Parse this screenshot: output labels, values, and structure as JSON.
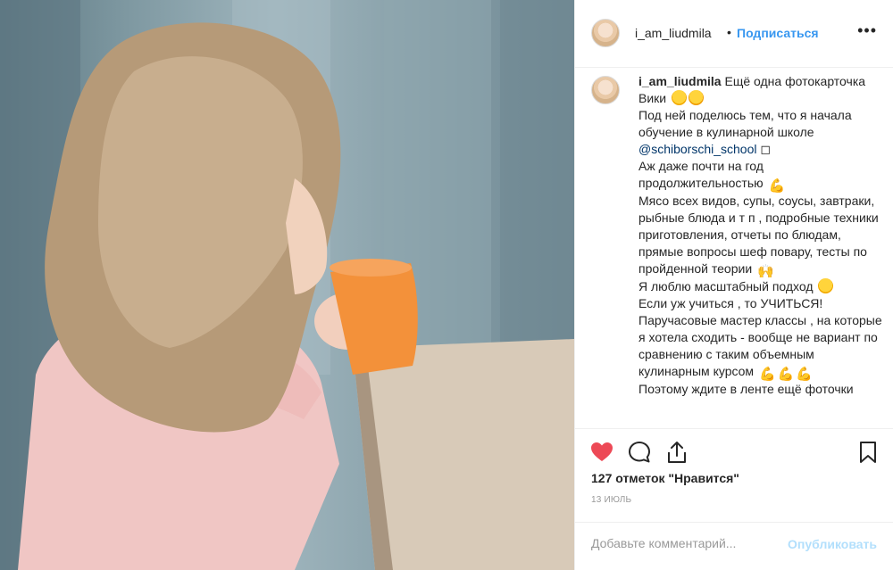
{
  "post": {
    "photo_alt": "",
    "header": {
      "username": "i_am_liudmila",
      "separator": "•",
      "follow_label": "Подписаться",
      "more_label": "•••"
    },
    "caption": {
      "username": "i_am_liudmila",
      "text_1": " Ещё одна фотокарточка Вики ",
      "text_2": "\nПод ней поделюсь тем, что я начала обучение в кулинарной школе\n",
      "mention": "@schiborschi_school",
      "text_3": " ◻\nАж даже почти на год продолжительностью ",
      "text_4": "\nМясо всех видов, супы, соусы, завтраки, рыбные блюда и т п , подробные техники приготовления, отчеты по блюдам, прямые вопросы шеф повару, тесты по пройденной теории ",
      "text_5": "\nЯ люблю масштабный подход ",
      "text_6": "\nЕсли уж учиться , то УЧИТЬСЯ!\nПаручасовые мастер классы , на которые я хотела сходить - вообще не вариант по сравнению с таким объемным кулинарным курсом ",
      "text_7": "\nПоэтому ждите в ленте ещё фоточки",
      "muscle": "💪",
      "hands": "🙌"
    },
    "likes": "127 отметок \"Нравится\"",
    "date": "13 ИЮЛЬ",
    "comment": {
      "placeholder": "Добавьте комментарий...",
      "value": "",
      "publish_label": "Опубликовать"
    },
    "colors": {
      "like": "#ed4956",
      "link": "#3897f0",
      "publish_disabled": "#b2dffc"
    },
    "icons": [
      "heart-icon",
      "comment-icon",
      "share-icon",
      "bookmark-icon",
      "more-icon"
    ]
  }
}
